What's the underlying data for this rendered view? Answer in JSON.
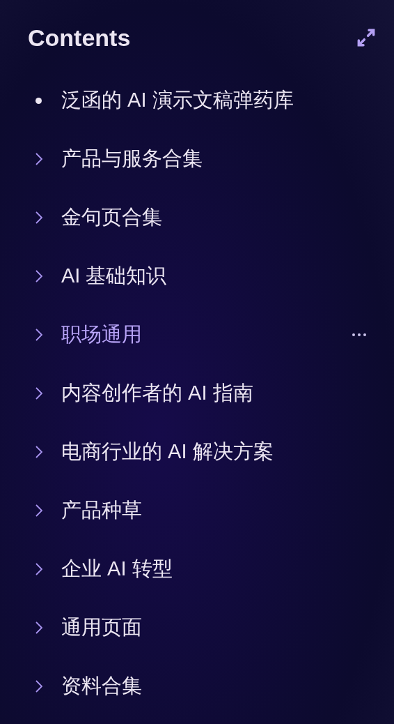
{
  "title": "Contents",
  "items": [
    {
      "kind": "leaf",
      "label": "泛函的 AI 演示文稿弹药库",
      "selected": false
    },
    {
      "kind": "folder",
      "label": "产品与服务合集",
      "selected": false
    },
    {
      "kind": "folder",
      "label": "金句页合集",
      "selected": false
    },
    {
      "kind": "folder",
      "label": "AI 基础知识",
      "selected": false
    },
    {
      "kind": "folder",
      "label": "职场通用",
      "selected": true
    },
    {
      "kind": "folder",
      "label": "内容创作者的 AI 指南",
      "selected": false
    },
    {
      "kind": "folder",
      "label": "电商行业的 AI 解决方案",
      "selected": false
    },
    {
      "kind": "folder",
      "label": "产品种草",
      "selected": false
    },
    {
      "kind": "folder",
      "label": "企业 AI 转型",
      "selected": false
    },
    {
      "kind": "folder",
      "label": "通用页面",
      "selected": false
    },
    {
      "kind": "folder",
      "label": "资料合集",
      "selected": false
    }
  ]
}
